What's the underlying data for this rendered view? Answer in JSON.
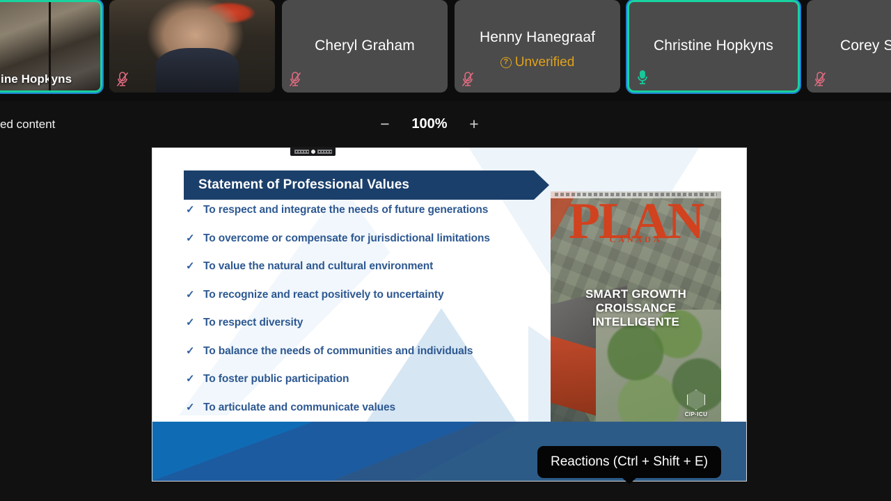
{
  "filmstrip": {
    "tiles": [
      {
        "name": "ine Hopkyns",
        "kind": "video",
        "active": true,
        "muted": false,
        "mic_icon": "mic-off-icon",
        "verified_label": "",
        "verify_icon": ""
      },
      {
        "name": "",
        "kind": "video",
        "active": false,
        "muted": true,
        "mic_icon": "mic-off-icon",
        "verified_label": "",
        "verify_icon": ""
      },
      {
        "name": "Cheryl Graham",
        "kind": "avatar",
        "active": false,
        "muted": true,
        "mic_icon": "mic-off-icon",
        "verified_label": "",
        "verify_icon": ""
      },
      {
        "name": "Henny Hanegraaf",
        "kind": "avatar",
        "active": false,
        "muted": true,
        "mic_icon": "mic-off-icon",
        "verified_label": "Unverified",
        "verify_icon": "question-circle-icon"
      },
      {
        "name": "Christine Hopkyns",
        "kind": "avatar",
        "active": true,
        "muted": false,
        "mic_icon": "mic-on-icon",
        "verified_label": "",
        "verify_icon": ""
      },
      {
        "name": "Corey S",
        "kind": "avatar",
        "active": false,
        "muted": true,
        "mic_icon": "mic-off-icon",
        "verified_label": "",
        "verify_icon": ""
      }
    ]
  },
  "sharebar": {
    "share_label": "ed content",
    "zoom_out_label": "−",
    "zoom_level": "100%",
    "zoom_in_label": "+"
  },
  "slide": {
    "title": "Statement of Professional Values",
    "bullets": [
      {
        "check": "✓",
        "text": "To respect and integrate the needs of future generations"
      },
      {
        "check": "✓",
        "text": "To overcome or compensate for jurisdictional limitations"
      },
      {
        "check": "✓",
        "text": "To value the natural and cultural environment"
      },
      {
        "check": "✓",
        "text": "To recognize and react positively to uncertainty"
      },
      {
        "check": "✓",
        "text": "To respect diversity"
      },
      {
        "check": "✓",
        "text": "To balance the needs of communities and individuals"
      },
      {
        "check": "✓",
        "text": "To foster public participation"
      },
      {
        "check": "✓",
        "text": "To articulate and communicate values"
      }
    ],
    "cover": {
      "masthead": "PLAN",
      "subtitle": "CANADA",
      "headline_en": "SMART GROWTH",
      "headline_fr_1": "CROISSANCE",
      "headline_fr_2": "INTELLIGENTE",
      "logo_text": "CIP·ICU"
    }
  },
  "tooltip": {
    "text": "Reactions (Ctrl + Shift + E)"
  },
  "colors": {
    "banner_navy": "#1b3f6b",
    "bullet_blue": "#2d5891",
    "footer_blue": "#2b5788",
    "active_border": "#18d2a0",
    "unverified_amber": "#e0a21c",
    "mic_muted_red": "#e06b80",
    "mic_active_green": "#18c79a",
    "cover_red": "#d1421f"
  }
}
